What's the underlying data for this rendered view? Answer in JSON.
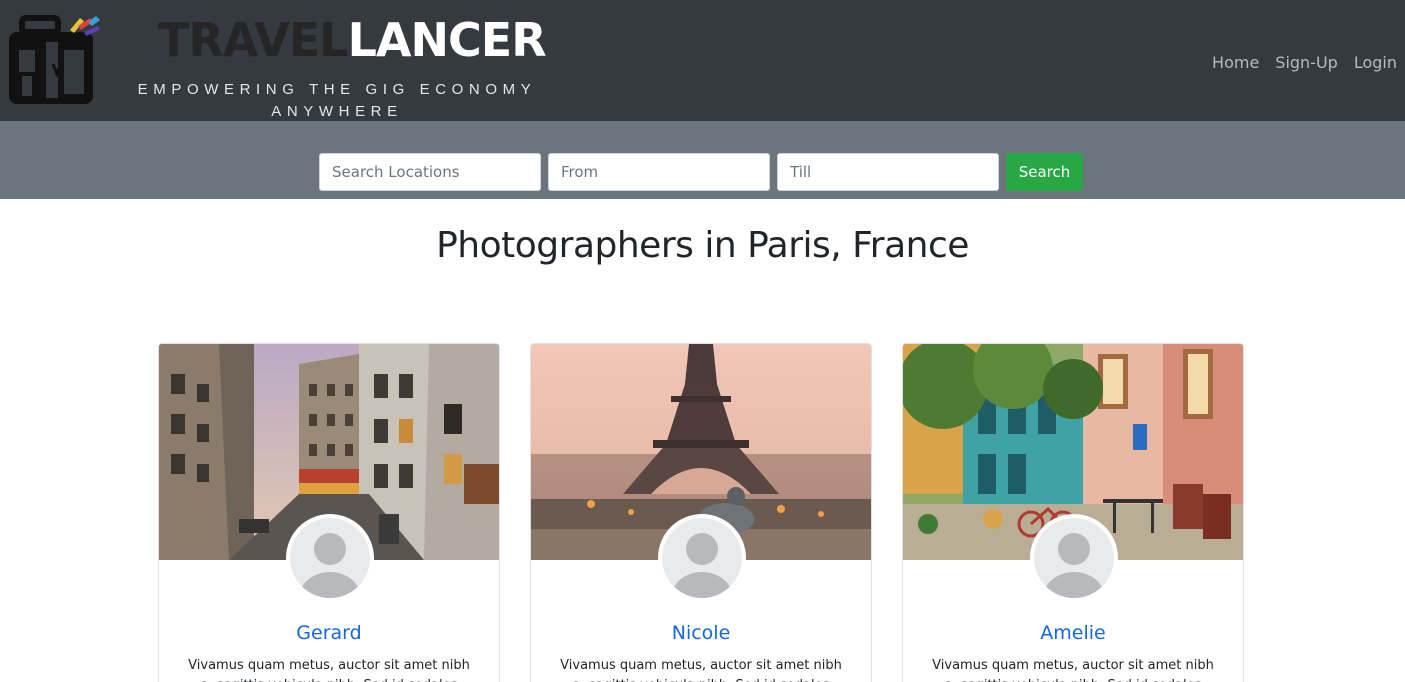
{
  "header": {
    "brand_part1": "TRAVEL",
    "brand_part2": "LANCER",
    "tagline": "EMPOWERING THE GIG ECONOMY ANYWHERE",
    "logo_icon": "suitcase-icon",
    "nav": [
      {
        "label": "Home"
      },
      {
        "label": "Sign-Up"
      },
      {
        "label": "Login"
      }
    ]
  },
  "search": {
    "location_placeholder": "Search Locations",
    "from_placeholder": "From",
    "till_placeholder": "Till",
    "button_label": "Search"
  },
  "page": {
    "title": "Photographers in Paris, France"
  },
  "cards": [
    {
      "name": "Gerard",
      "text": "Vivamus quam metus, auctor sit amet nibh a, sagittis vehicula nibh. Sed id sodales"
    },
    {
      "name": "Nicole",
      "text": "Vivamus quam metus, auctor sit amet nibh a, sagittis vehicula nibh. Sed id sodales"
    },
    {
      "name": "Amelie",
      "text": "Vivamus quam metus, auctor sit amet nibh a, sagittis vehicula nibh. Sed id sodales"
    }
  ],
  "colors": {
    "navbar": "#343a40",
    "searchbar": "#6c757d",
    "search_button": "#28a745",
    "name_link": "#1168e6"
  }
}
